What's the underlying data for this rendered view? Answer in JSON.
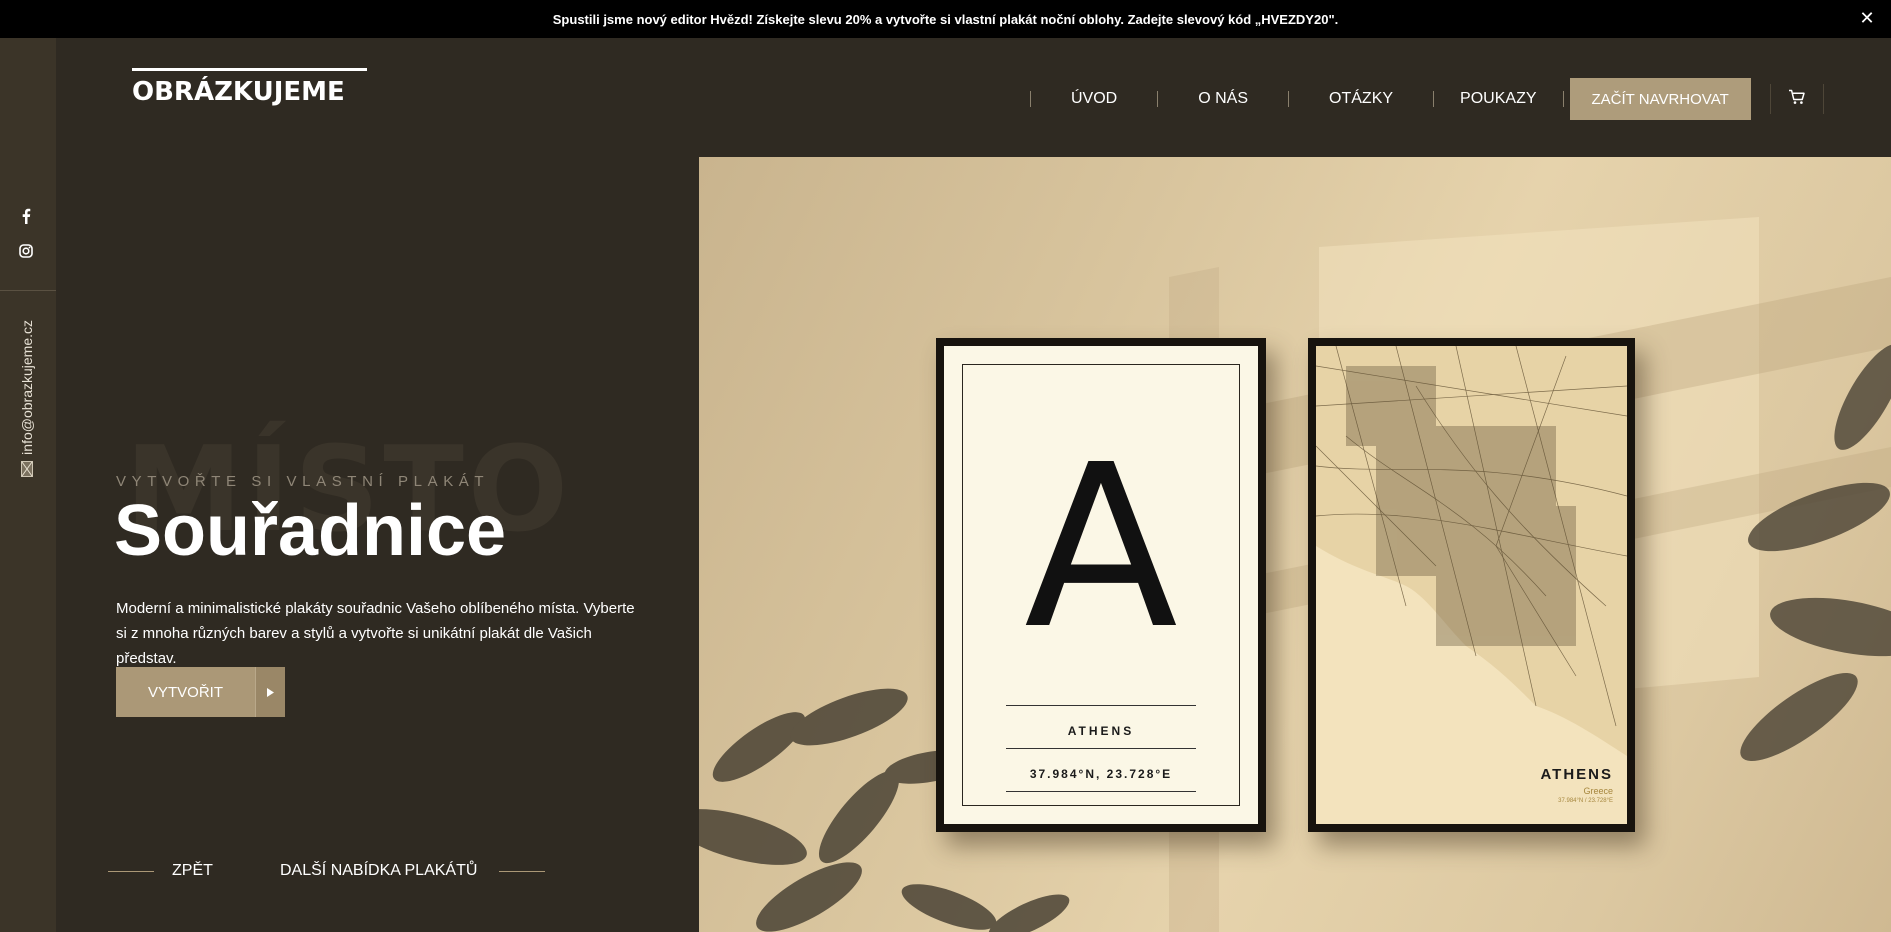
{
  "announcement": {
    "text": "Spustili jsme nový editor Hvězd! Získejte slevu 20% a vytvořte si vlastní plakát noční oblohy. Zadejte slevový kód „HVEZDY20\".",
    "close_symbol": "✕"
  },
  "sidebar": {
    "email": "info@obrazkujeme.cz",
    "icons": [
      "facebook-icon",
      "instagram-icon",
      "mail-icon"
    ]
  },
  "header": {
    "logo": "OBRÁZKUJEME",
    "nav": [
      "ÚVOD",
      "O NÁS",
      "OTÁZKY",
      "POUKAZY"
    ],
    "cta": "ZAČÍT NAVRHOVAT",
    "cart_icon": "cart-icon"
  },
  "hero": {
    "ghost_text": "MÍSTO",
    "kicker": "VYTVOŘTE SI VLASTNÍ PLAKÁT",
    "title": "Souřadnice",
    "description": "Moderní a minimalistické plakáty souřadnic Vašeho oblíbeného místa. Vyberte si z mnoha různých barev a stylů a vytvořte si unikátní plakát dle Vašich představ.",
    "button": "VYTVOŘIT",
    "back": "ZPĚT",
    "next": "DALŠÍ NABÍDKA PLAKÁTŮ"
  },
  "posters": {
    "letter": "A",
    "city": "ATHENS",
    "coords": "37.984°N, 23.728°E",
    "map_city": "ATHENS",
    "map_country": "Greece",
    "map_coords": "37.984°N / 23.728°E"
  },
  "colors": {
    "background": "#2f2a22",
    "rail": "#3b3428",
    "accent": "#ae9c7b",
    "topbar": "#000000"
  }
}
